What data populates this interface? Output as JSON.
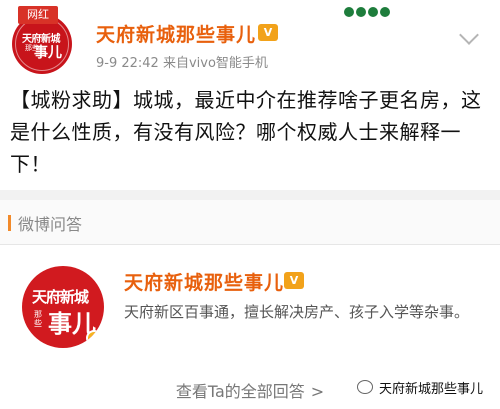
{
  "post": {
    "avatar_badge": "网红",
    "avatar_text": {
      "line1": "天府新城",
      "small": "那些",
      "big": "事儿"
    },
    "account_name": "天府新城那些事儿",
    "verified_icon": "v-badge-icon",
    "meta": "9-9 22:42   来自vivo智能手机",
    "content": "【城粉求助】城城，最近中介在推荐啥子更名房，这是什么性质，有没有风险？哪个权威人士来解释一下！",
    "more_icon": "chevron-down-icon"
  },
  "qa": {
    "section_label": "微博问答",
    "avatar_text": {
      "line1": "天府新城",
      "small": "那些",
      "big": "事儿"
    },
    "account_name": "天府新城那些事儿",
    "verified_icon": "v-badge-icon",
    "description": "天府新区百事通，擅长解决房产、孩子入学等杂事。",
    "see_all": "查看Ta的全部回答",
    "see_all_caret": ">"
  },
  "watermark": {
    "text": "天府新城那些事儿"
  },
  "colors": {
    "accent_orange": "#e8600d",
    "badge_red": "#d83227",
    "avatar_red": "#c8141b",
    "verified_gold": "#f2a21a"
  }
}
